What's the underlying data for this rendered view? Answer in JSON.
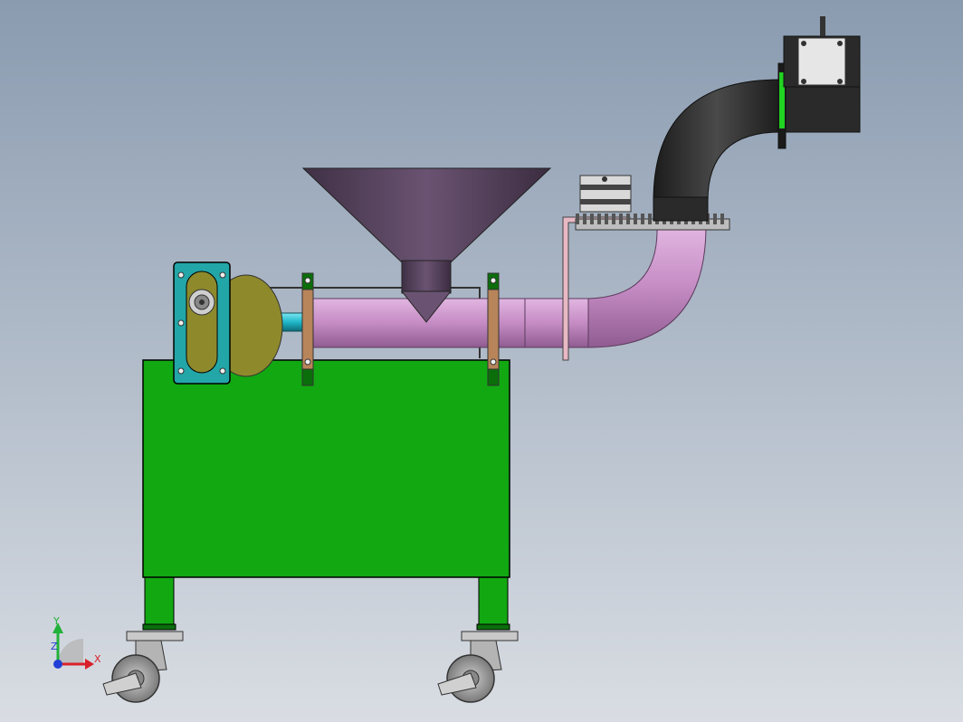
{
  "viewport": {
    "background_top": "#8a9bb0",
    "background_bottom": "#d9dde3"
  },
  "colors": {
    "frame_green": "#12a812",
    "frame_dark_green": "#0b6e0b",
    "barrel_pink": "#c58cc4",
    "barrel_shadow": "#9a6a9c",
    "hopper_purple": "#5a4660",
    "hood_black": "#2a2a2a",
    "bearing_teal": "#23a6a8",
    "pulley_olive": "#8e8a2c",
    "shaft_cyan": "#1fb7c9",
    "clamp_copper": "#b8845a",
    "motor_grey": "#d9d9d9",
    "wheel_grey": "#9a9a9a",
    "green_seal": "#22d322"
  },
  "triad": {
    "x_label": "X",
    "y_label": "Y",
    "z_label": "Z",
    "x_color": "#d9202a",
    "y_color": "#22b13a",
    "z_color": "#1f3fd6"
  },
  "icons": {
    "triad": "coordinate-triad-icon"
  }
}
